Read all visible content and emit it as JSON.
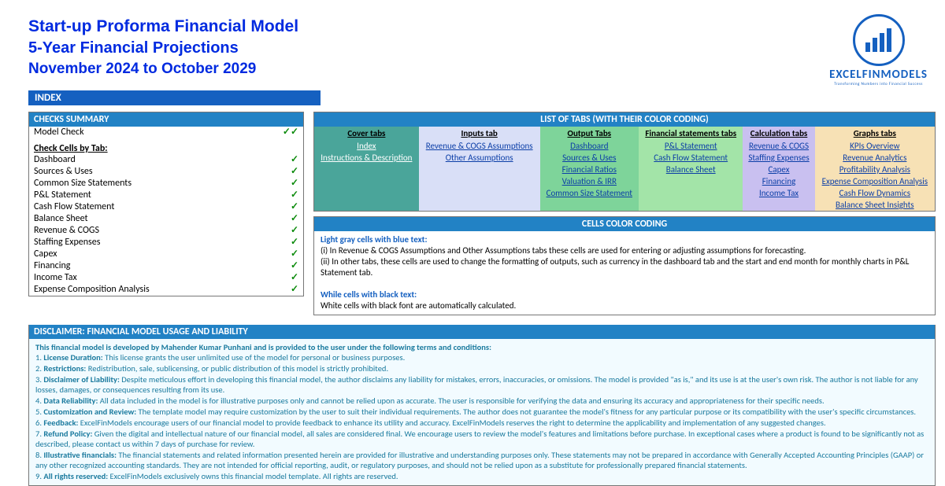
{
  "header": {
    "title1": "Start-up Proforma Financial Model",
    "title2": "5-Year Financial Projections",
    "title3": "November 2024 to October 2029"
  },
  "logo": {
    "name": "EXCELFINMODELS",
    "tag": "Transforming Numbers into Financial Success"
  },
  "index_label": "INDEX",
  "checks": {
    "header": "CHECKS  SUMMARY",
    "model_check": {
      "label": "Model Check",
      "mark": "✓✓"
    },
    "by_tab_title": "Check Cells by Tab:",
    "rows": [
      {
        "label": "Dashboard",
        "mark": "✓"
      },
      {
        "label": "Sources & Uses",
        "mark": "✓"
      },
      {
        "label": "Common Size Statements",
        "mark": "✓"
      },
      {
        "label": "P&L Statement",
        "mark": "✓"
      },
      {
        "label": "Cash Flow Statement",
        "mark": "✓"
      },
      {
        "label": "Balance Sheet",
        "mark": "✓"
      },
      {
        "label": "Revenue & COGS",
        "mark": "✓"
      },
      {
        "label": "Staffing Expenses",
        "mark": "✓"
      },
      {
        "label": "Capex",
        "mark": "✓"
      },
      {
        "label": "Financing",
        "mark": "✓"
      },
      {
        "label": "Income Tax",
        "mark": "✓"
      },
      {
        "label": "Expense Composition Analysis",
        "mark": "✓"
      }
    ]
  },
  "tabs": {
    "header": "LIST OF TABS (WITH THEIR COLOR CODING)",
    "columns": [
      "Cover tabs",
      "Inputs tab",
      "Output Tabs",
      "Financial statements tabs",
      "Calculation tabs",
      "Graphs tabs"
    ],
    "cover": [
      "Index",
      "Instructions & Description"
    ],
    "inputs": [
      "Revenue & COGS Assumptions",
      "Other Assumptions"
    ],
    "output": [
      "Dashboard",
      "Sources & Uses",
      "Financial Ratios",
      "Valuation & IRR",
      "Common Size Statement"
    ],
    "fin": [
      "P&L Statement",
      "Cash Flow Statement",
      "Balance Sheet"
    ],
    "calc": [
      "Revenue & COGS",
      "Staffing Expenses",
      "Capex",
      "Financing",
      "Income Tax"
    ],
    "graphs": [
      "KPIs Overview",
      "Revenue Analytics",
      "Profitability Analysis",
      "Expense Composition Analysis",
      "Cash Flow Dynamics",
      "Balance Sheet Insights"
    ]
  },
  "coding": {
    "header": "CELLS COLOR CODING",
    "label1": "Light gray cells with blue text:",
    "line1": "(i) In Revenue & COGS Assumptions and Other Assumptions tabs these cells are used for entering or adjusting assumptions for forecasting.",
    "line2": "(ii) In other tabs, these cells are used to change the formatting of outputs, such as currency in the dashboard tab and the start and end month for monthly charts in P&L Statement tab.",
    "label2": "While cells with black text:",
    "line3": "White cells with black font are automatically calculated."
  },
  "disc": {
    "header": "DISCLAIMER: FINANCIAL MODEL USAGE AND LIABILITY",
    "intro": "This financial model  is developed by Mahender Kumar Punhani and is provided to the user under the following terms and conditions:",
    "items": [
      {
        "n": "1.",
        "t": "License Duration:",
        "b": "This license grants the user unlimited use of the model for personal or business purposes."
      },
      {
        "n": "2.",
        "t": "Restrictions:",
        "b": "Redistribution, sale, sublicensing, or public distribution of this model is strictly prohibited."
      },
      {
        "n": "3.",
        "t": "Disclaimer of Liability:",
        "b": "Despite meticulous effort in developing this financial model, the author disclaims any liability for mistakes, errors, inaccuracies, or omissions. The model is provided \"as is,\" and its use is at the user's own risk. The author is  not liable for any  losses, damages, or consequences resulting from its use."
      },
      {
        "n": "4.",
        "t": "Data Reliability:",
        "b": "All data included in the model is for illustrative purposes only and cannot be relied upon as accurate. The user is  responsible for verifying the data and ensuring its accuracy and appropriateness for their specific needs."
      },
      {
        "n": "5.",
        "t": "Customization and Review:",
        "b": "The template model may require customization by the user to suit their individual requirements. The author does not guarantee the model's fitness for any  particular purpose or its compatibility with the user's specific circumstances."
      },
      {
        "n": "6.",
        "t": "Feedback:",
        "b": "ExcelFinModels encourage users of our financial model to provide feedback to enhance its utility and accuracy. ExcelFinModels reserves the right to determine the applicability and implementation of any suggested changes."
      },
      {
        "n": "7.",
        "t": "Refund Policy:",
        "b": "Given the digital and intellectual nature of our financial model, all sales are considered final. We encourage users to review the model's features and limitations before purchase. In exceptional cases where a product is found to be  significantly not as described, please contact us within 7 days of purchase for review."
      },
      {
        "n": "8.",
        "t": "Illustrative financials:",
        "b": "The financial statements and related information presented herein are provided for illustrative and understanding purposes only. These statements may not be prepared in accordance with Generally Accepted Accounting Principles (GAAP) or any other  recognized accounting standards. They are not intended for official reporting, audit, or regulatory purposes, and should not be relied upon as a substitute for professionally prepared financial statements."
      },
      {
        "n": "9.",
        "t": "All rights reserved:",
        "b": "ExcelFinModels exclusively owns this financial model template. All rights are reserved."
      }
    ]
  }
}
